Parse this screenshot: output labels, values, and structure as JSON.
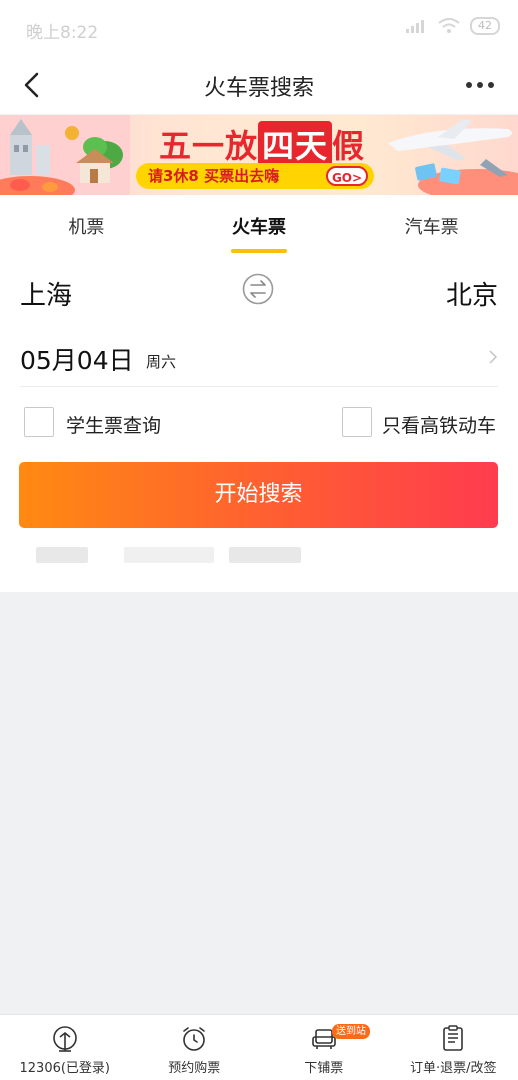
{
  "status_bar": {
    "time": "晚上8:22",
    "battery": "42"
  },
  "header": {
    "title": "火车票搜索"
  },
  "banner": {
    "title_part1": "五一放",
    "title_boxed": "四天",
    "title_part2": "假",
    "subtitle": "请3休8 买票出去嗨",
    "go_label": "GO>"
  },
  "tabs": [
    {
      "label": "机票"
    },
    {
      "label": "火车票"
    },
    {
      "label": "汽车票"
    }
  ],
  "form": {
    "from_city": "上海",
    "to_city": "北京",
    "date": "05月04日",
    "weekday": "周六",
    "student_ticket_label": "学生票查询",
    "gaotie_only_label": "只看高铁动车",
    "search_label": "开始搜索"
  },
  "bottom_nav": {
    "items": [
      {
        "label": "12306(已登录)",
        "icon": "train-station-icon"
      },
      {
        "label": "预约购票",
        "icon": "alarm-clock-icon"
      },
      {
        "label": "下铺票",
        "icon": "armchair-icon",
        "badge": "送到站"
      },
      {
        "label": "订单·退票/改签",
        "icon": "order-list-icon"
      }
    ]
  },
  "colors": {
    "accent_yellow": "#ffbe0b",
    "button_start": "#ff8a12",
    "button_end": "#ff3c4f"
  }
}
